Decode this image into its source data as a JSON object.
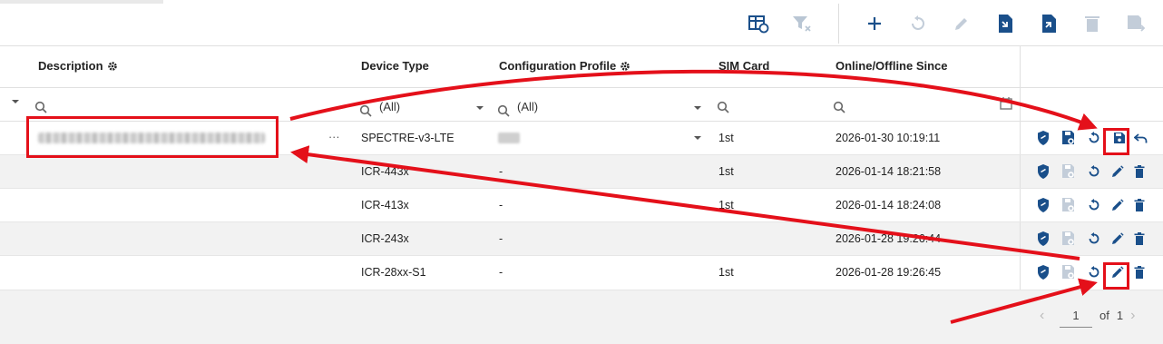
{
  "toolbar": {
    "icons": [
      "table-refresh-icon",
      "clear-filter-icon",
      "add-icon",
      "reset-icon",
      "edit-icon",
      "import-icon",
      "export-icon",
      "delete-icon",
      "save-to-icon"
    ]
  },
  "columns": {
    "description": "Description",
    "device_type": "Device Type",
    "config_profile": "Configuration Profile",
    "sim_card": "SIM Card",
    "online_since": "Online/Offline Since"
  },
  "filters": {
    "device_type": "(All)",
    "config_profile": "(All)"
  },
  "rows": [
    {
      "device_type": "SPECTRE-v3-LTE",
      "config_profile": "",
      "sim_card": "1st",
      "online_since": "2026-01-30 10:19:11",
      "more": "···"
    },
    {
      "device_type": "ICR-443x",
      "config_profile": "-",
      "sim_card": "1st",
      "online_since": "2026-01-14 18:21:58"
    },
    {
      "device_type": "ICR-413x",
      "config_profile": "-",
      "sim_card": "1st",
      "online_since": "2026-01-14 18:24:08"
    },
    {
      "device_type": "ICR-243x",
      "config_profile": "-",
      "sim_card": "",
      "online_since": "2026-01-28 19:26:44"
    },
    {
      "device_type": "ICR-28xx-S1",
      "config_profile": "-",
      "sim_card": "1st",
      "online_since": "2026-01-28 19:26:45"
    }
  ],
  "pagination": {
    "current": "1",
    "of_label": "of",
    "total": "1"
  },
  "colors": {
    "accent": "#1a4f8a",
    "annotation": "#e4101a",
    "row_alt": "#f2f2f2"
  }
}
